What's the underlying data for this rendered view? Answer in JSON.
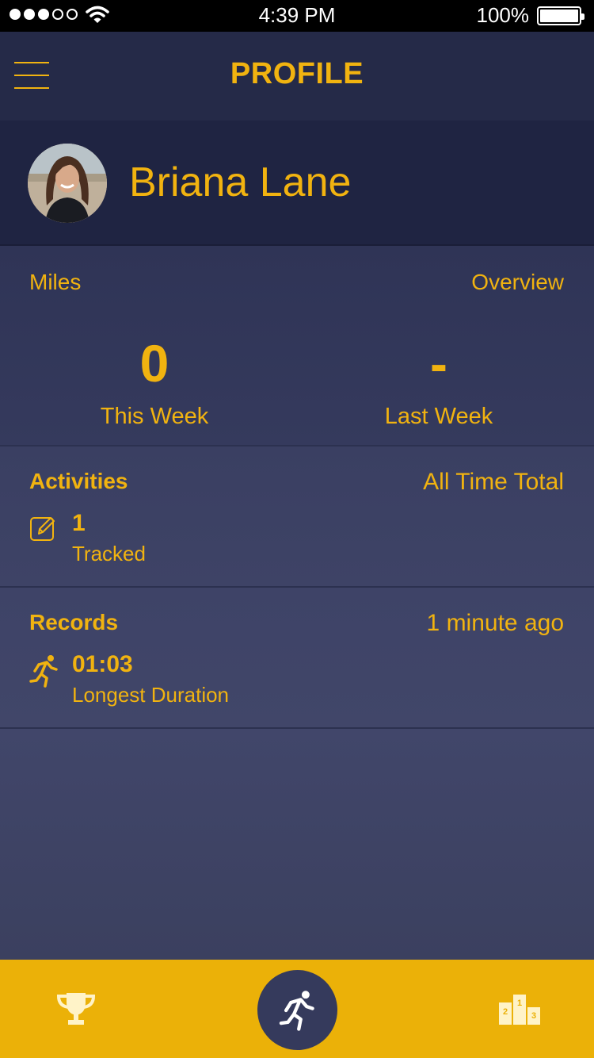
{
  "status_bar": {
    "time": "4:39 PM",
    "battery": "100%",
    "signal_dots": [
      true,
      true,
      true,
      false,
      false
    ],
    "icons": [
      "wifi-icon",
      "battery-icon"
    ]
  },
  "header": {
    "title": "PROFILE",
    "menu_icon": "hamburger-menu-icon"
  },
  "profile": {
    "name": "Briana Lane",
    "avatar_icon": "avatar"
  },
  "miles": {
    "title": "Miles",
    "link": "Overview",
    "stats": [
      {
        "value": "0",
        "label": "This Week"
      },
      {
        "value": "-",
        "label": "Last Week"
      }
    ]
  },
  "activities": {
    "title": "Activities",
    "scope": "All Time Total",
    "items": [
      {
        "icon": "edit-icon",
        "value": "1",
        "label": "Tracked"
      }
    ]
  },
  "records": {
    "title": "Records",
    "updated": "1 minute ago",
    "items": [
      {
        "icon": "running-icon",
        "value": "01:03",
        "label": "Longest Duration"
      }
    ]
  },
  "tab_bar": {
    "tabs": [
      {
        "icon": "trophy-icon"
      },
      {
        "icon": "running-icon",
        "active": true
      },
      {
        "icon": "podium-icon",
        "labels": [
          "2",
          "1",
          "3"
        ]
      }
    ]
  },
  "colors": {
    "accent": "#f1b310",
    "background": "#2a2f4f",
    "tab_bar": "#ebb108",
    "active_tab": "#353a5c"
  }
}
